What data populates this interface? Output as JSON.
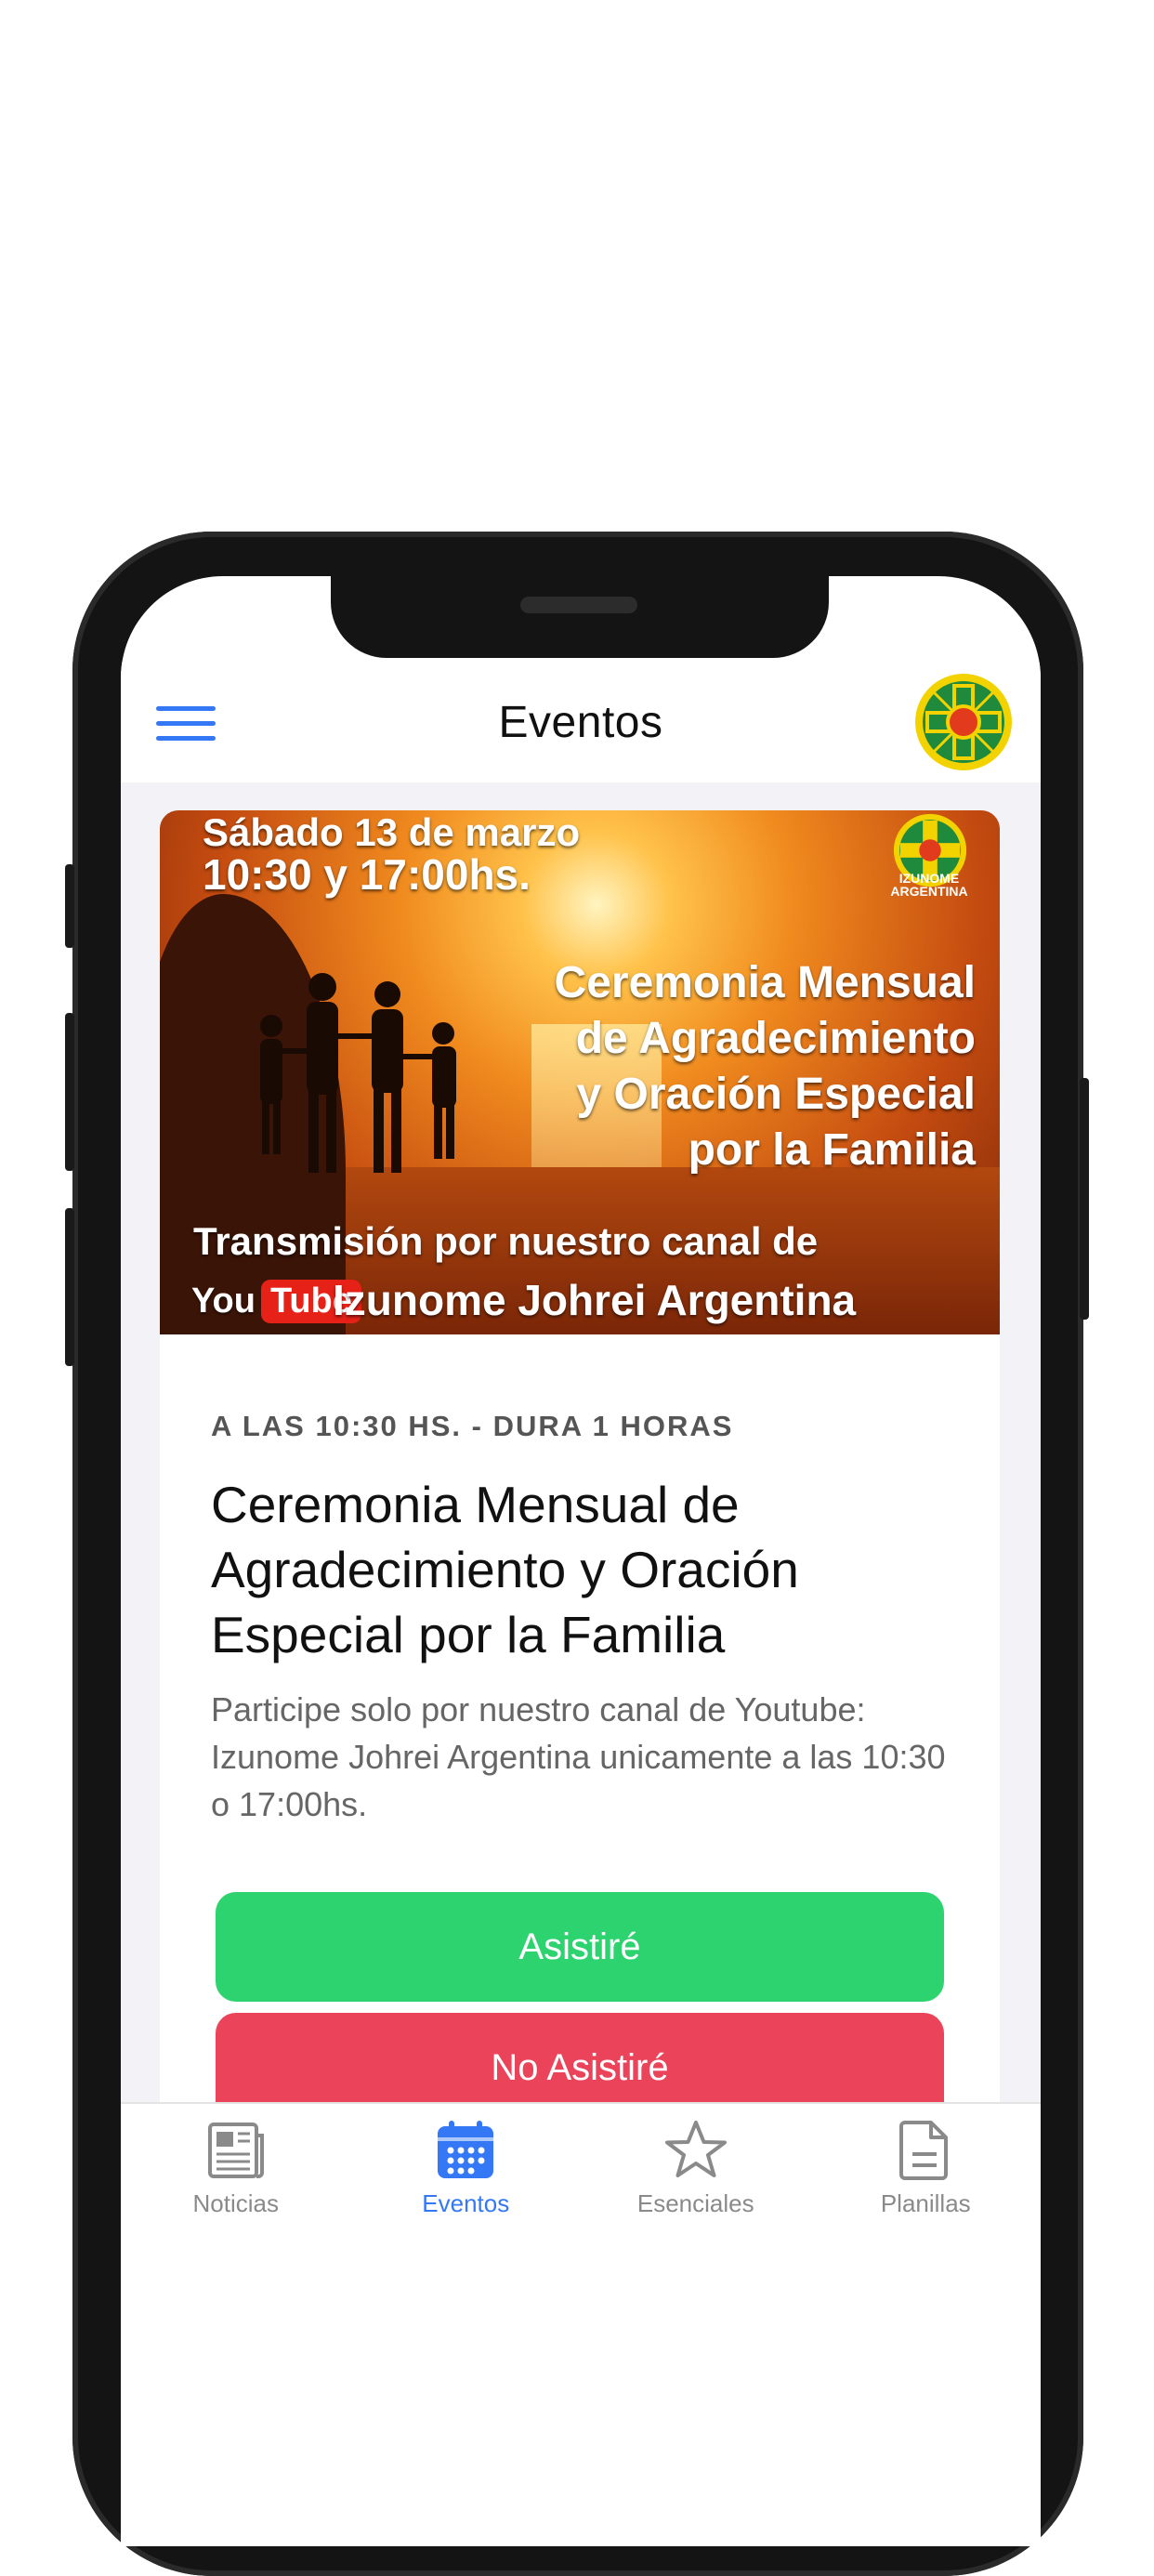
{
  "header": {
    "title": "Eventos"
  },
  "banner": {
    "date_line": "Sábado 13 de marzo",
    "time_line": "10:30 y 17:00hs.",
    "title_lines": [
      "Ceremonia Mensual",
      "de Agradecimiento",
      "y Oración Especial",
      "por la Familia"
    ],
    "transmission": "Transmisión por nuestro canal de",
    "youtube_you": "You",
    "youtube_tube": "Tube",
    "channel": "Izunome Johrei Argentina",
    "logo_text": "IZUNOME ARGENTINA"
  },
  "event": {
    "meta": "A LAS 10:30 HS. - DURA 1 HORAS",
    "title": "Ceremonia Mensual de Agradecimiento y Oración Especial por la Familia",
    "description": "Participe solo por nuestro canal de Youtube: Izunome Johrei Argentina unicamente a las 10:30 o 17:00hs.",
    "attend_label": "Asistiré",
    "not_attend_label": "No Asistiré"
  },
  "tabs": [
    {
      "label": "Noticias",
      "icon": "newspaper-icon",
      "active": false
    },
    {
      "label": "Eventos",
      "icon": "calendar-icon",
      "active": true
    },
    {
      "label": "Esenciales",
      "icon": "star-icon",
      "active": false
    },
    {
      "label": "Planillas",
      "icon": "document-icon",
      "active": false
    }
  ],
  "colors": {
    "accent": "#3478f6",
    "attend": "#2dd36f",
    "not_attend": "#eb445a"
  }
}
